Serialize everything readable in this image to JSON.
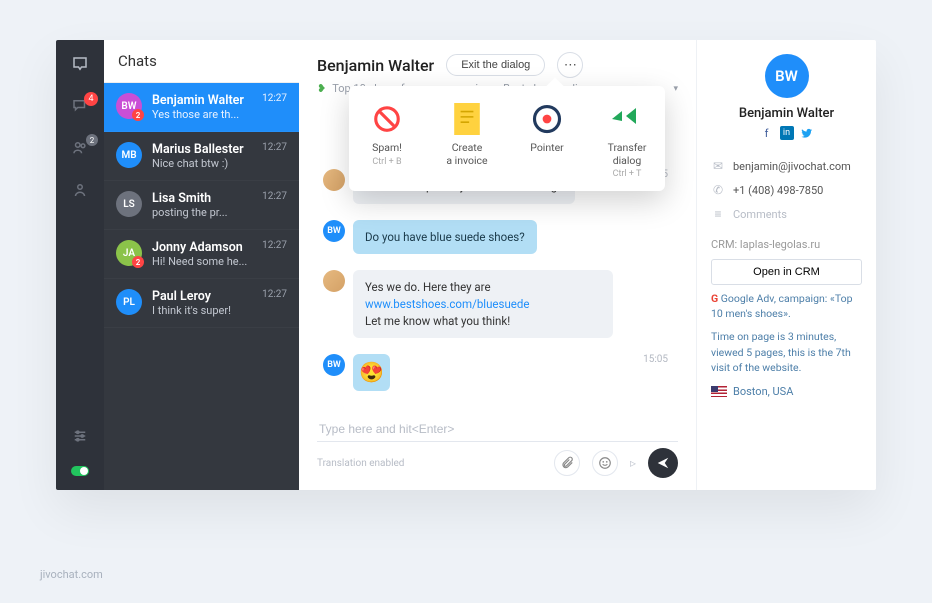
{
  "watermark": "jivochat.com",
  "nav": {
    "items": [
      {
        "icon": "inbox-icon",
        "badge": null
      },
      {
        "icon": "chat-icon",
        "badge": "4"
      },
      {
        "icon": "users-icon",
        "badge": "2"
      },
      {
        "icon": "profile-icon",
        "badge": null
      }
    ],
    "settings_icon": "sliders-icon"
  },
  "chatlist": {
    "header": "Chats",
    "items": [
      {
        "initials": "BW",
        "name": "Benjamin Walter",
        "preview": "Yes those are th...",
        "time": "12:27",
        "color": "#c94fd6",
        "badge": "2",
        "selected": true
      },
      {
        "initials": "MB",
        "name": "Marius Ballester",
        "preview": "Nice chat btw :)",
        "time": "12:27",
        "color": "#1f8efa",
        "badge": null,
        "selected": false
      },
      {
        "initials": "LS",
        "name": "Lisa Smith",
        "preview": "posting the pr...",
        "time": "12:27",
        "color": "#6d727d",
        "badge": null,
        "selected": false
      },
      {
        "initials": "JA",
        "name": "Jonny Adamson",
        "preview": "Hi! Need some he...",
        "time": "12:27",
        "color": "#8bc34a",
        "badge": "2",
        "selected": false
      },
      {
        "initials": "PL",
        "name": "Paul Leroy",
        "preview": "I think it's super!",
        "time": "12:27",
        "color": "#1f8efa",
        "badge": null,
        "selected": false
      }
    ]
  },
  "thread": {
    "title": "Benjamin Walter",
    "exit_label": "Exit the dialog",
    "subtitle": "Top 10 shoes for every occasion – Best shoes online",
    "popover": [
      {
        "icon": "ban-icon",
        "label": "Spam!",
        "hint": "Ctrl + B"
      },
      {
        "icon": "invoice-icon",
        "label": "Create\na invoice",
        "hint": ""
      },
      {
        "icon": "pointer-icon",
        "label": "Pointer",
        "hint": ""
      },
      {
        "icon": "transfer-icon",
        "label": "Transfer\ndialog",
        "hint": "Ctrl + T"
      }
    ],
    "messages": [
      {
        "side": "agent",
        "avatar": "photo",
        "text": "Hi! Can I help with you find something?",
        "time": "15:05"
      },
      {
        "side": "visitor",
        "avatar": "BW",
        "text": "Do you have blue suede shoes?",
        "time": ""
      },
      {
        "side": "agent",
        "avatar": "photo",
        "text": "Yes we do. Here they are ",
        "link": "www.bestshoes.com/bluesuede",
        "text2": "Let me know what you think!",
        "time": ""
      },
      {
        "side": "visitor",
        "avatar": "BW",
        "emoji": "😍",
        "time": "15:05"
      }
    ],
    "composer": {
      "placeholder": "Type here and hit<Enter>",
      "hint": "Translation enabled"
    }
  },
  "details": {
    "initials": "BW",
    "name": "Benjamin Walter",
    "email": "benjamin@jivochat.com",
    "phone": "+1 (408) 498-7850",
    "comments_label": "Comments",
    "crm_label": "CRM: laplas-legolas.ru",
    "crm_button": "Open in CRM",
    "adv_text": "Google Adv, campaign: «Top 10 men's shoes».",
    "visit_text": "Time on page is 3 minutes, viewed 5 pages, this is the 7th visit of the website.",
    "location": "Boston, USA"
  }
}
